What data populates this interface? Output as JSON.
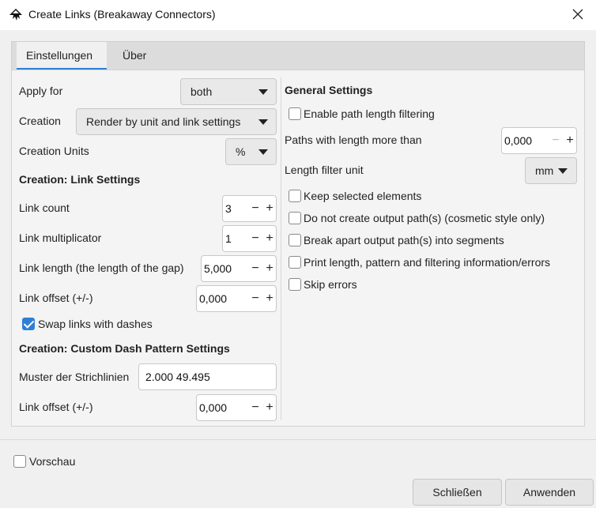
{
  "window": {
    "title": "Create Links (Breakaway Connectors)"
  },
  "tabs": [
    {
      "label": "Einstellungen",
      "active": true
    },
    {
      "label": "Über",
      "active": false
    }
  ],
  "left": {
    "apply_for": {
      "label": "Apply for",
      "value": "both"
    },
    "creation": {
      "label": "Creation",
      "value": "Render by unit and link settings"
    },
    "creation_units": {
      "label": "Creation Units",
      "value": "%"
    },
    "link_settings_header": "Creation: Link Settings",
    "link_count": {
      "label": "Link count",
      "value": "3"
    },
    "link_multiplicator": {
      "label": "Link multiplicator",
      "value": "1"
    },
    "link_length": {
      "label": "Link length (the length of the gap)",
      "value": "5,000"
    },
    "link_offset": {
      "label": "Link offset (+/-)",
      "value": "0,000"
    },
    "swap_links": {
      "label": "Swap links with dashes",
      "checked": true
    },
    "dash_header": "Creation: Custom Dash Pattern Settings",
    "dash_pattern": {
      "label": "Muster der Strichlinien",
      "value": "2.000 49.495"
    },
    "dash_offset": {
      "label": "Link offset (+/-)",
      "value": "0,000"
    }
  },
  "right": {
    "general_header": "General Settings",
    "enable_filter": {
      "label": "Enable path length filtering",
      "checked": false
    },
    "paths_length": {
      "label": "Paths with length more than",
      "value": "0,000"
    },
    "length_unit": {
      "label": "Length filter unit",
      "value": "mm"
    },
    "keep_selected": {
      "label": "Keep selected elements",
      "checked": false
    },
    "no_output": {
      "label": "Do not create output path(s) (cosmetic style only)",
      "checked": false
    },
    "break_apart": {
      "label": "Break apart output path(s) into segments",
      "checked": false
    },
    "print_info": {
      "label": "Print length, pattern and filtering information/errors",
      "checked": false
    },
    "skip_errors": {
      "label": "Skip errors",
      "checked": false
    }
  },
  "footer": {
    "preview": {
      "label": "Vorschau",
      "checked": false
    },
    "close_label": "Schließen",
    "apply_label": "Anwenden"
  },
  "icons": {
    "app": "inkscape-icon",
    "close": "close-icon",
    "arrow": "chevron-down-icon"
  },
  "colors": {
    "accent": "#2f7fd6",
    "window_bg": "#f0f0f0",
    "titlebar_bg": "#ffffff"
  }
}
